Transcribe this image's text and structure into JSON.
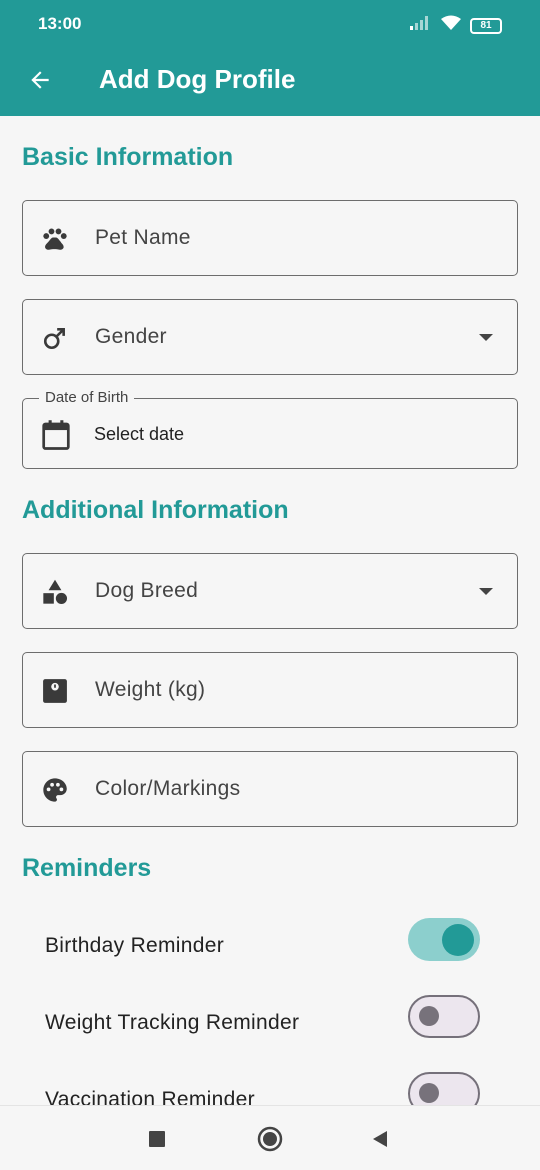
{
  "status": {
    "time": "13:00",
    "battery": "81"
  },
  "app_bar": {
    "title": "Add Dog Profile"
  },
  "sections": {
    "basic": "Basic Information",
    "additional": "Additional Information",
    "reminders": "Reminders"
  },
  "fields": {
    "pet_name": {
      "placeholder": "Pet Name",
      "icon": "paw-icon"
    },
    "gender": {
      "placeholder": "Gender",
      "icon": "male-icon"
    },
    "dob": {
      "label": "Date of Birth",
      "value": "Select date",
      "icon": "calendar-icon"
    },
    "breed": {
      "placeholder": "Dog Breed",
      "icon": "category-icon"
    },
    "weight": {
      "placeholder": "Weight (kg)",
      "icon": "scale-icon"
    },
    "color": {
      "placeholder": "Color/Markings",
      "icon": "palette-icon"
    }
  },
  "reminders": [
    {
      "label": "Birthday Reminder",
      "on": true
    },
    {
      "label": "Weight Tracking Reminder",
      "on": false
    },
    {
      "label": "Vaccination Reminder",
      "on": false
    }
  ],
  "colors": {
    "primary": "#229a97",
    "switch_track_on": "#8ccfcd",
    "background": "#f6f6f6"
  }
}
